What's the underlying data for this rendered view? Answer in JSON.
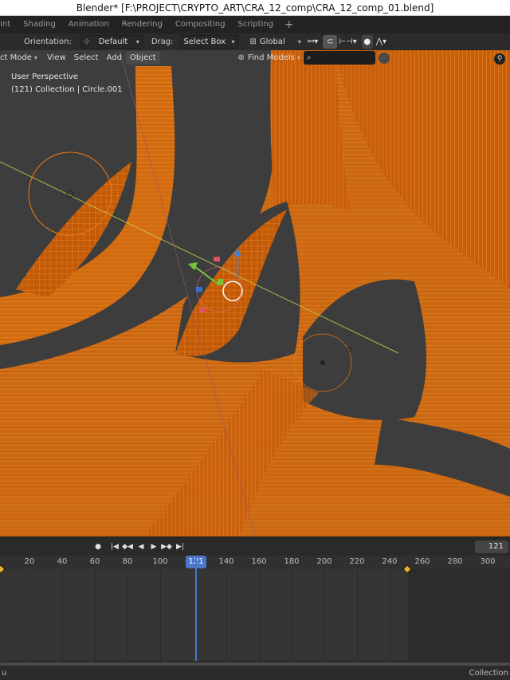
{
  "window": {
    "title": "Blender* [F:\\PROJECT\\CRYPTO_ART\\CRA_12_comp\\CRA_12_comp_01.blend]"
  },
  "workspace_tabs": [
    "aint",
    "Shading",
    "Animation",
    "Rendering",
    "Compositing",
    "Scripting"
  ],
  "workspace_add": "+",
  "toolbar": {
    "orientation_label": "Orientation:",
    "orientation_value": "Default",
    "drag_label": "Drag:",
    "drag_value": "Select Box",
    "transform_space": "Global"
  },
  "viewport_header": {
    "mode": "ct Mode",
    "menus": [
      "View",
      "Select",
      "Add",
      "Object"
    ],
    "find_models": "Find Models",
    "search_value": ""
  },
  "viewport": {
    "perspective": "User Perspective",
    "collection_info": "(121) Collection | Circle.001",
    "colors": {
      "wire": "#f07a10",
      "wire_dark": "#b85400",
      "background": "#3d3d3d"
    }
  },
  "timeline": {
    "current_frame": "121",
    "ruler_ticks": [
      "20",
      "40",
      "60",
      "80",
      "100",
      "121",
      "140",
      "160",
      "180",
      "200",
      "220",
      "240",
      "260",
      "280",
      "300"
    ],
    "frame_field": "121"
  },
  "statusbar": {
    "left": "u",
    "right": "Collection"
  }
}
